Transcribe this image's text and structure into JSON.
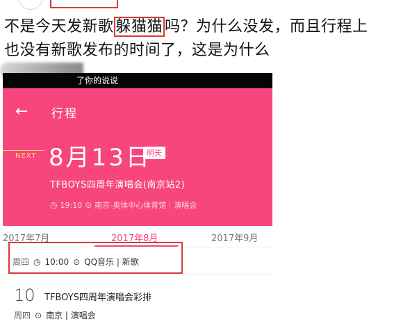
{
  "post": {
    "line1_a": "不是今天发新歌",
    "line1_highlight": "躲猫猫",
    "line1_b": "吗？为什么没发，而且行程上",
    "line2": "也没有新歌发布的时间了，这是为什么"
  },
  "screenshot": {
    "status_text": "了你的说说",
    "header_title": "行程",
    "next_label": "NEXT",
    "date_big": "8月13日",
    "tomorrow_badge": "明天",
    "event_title": "TFBOYS四周年演唱会(南京站2)",
    "event_time": "19:10",
    "event_location": "南京-奥体中心体育馆｜演唱会",
    "months": [
      "2017年7月",
      "2017年8月",
      "2017年9月"
    ],
    "schedule1": {
      "weekday": "周四",
      "time": "10:00",
      "place": "QQ音乐 | 新歌"
    },
    "schedule2": {
      "day": "10",
      "title": "TFBOYS四周年演唱会彩排",
      "weekday": "周四",
      "place": "南京 | 演唱会"
    }
  },
  "colors": {
    "accent_pink": "#f7457e",
    "highlight_red": "#d83a3a"
  }
}
